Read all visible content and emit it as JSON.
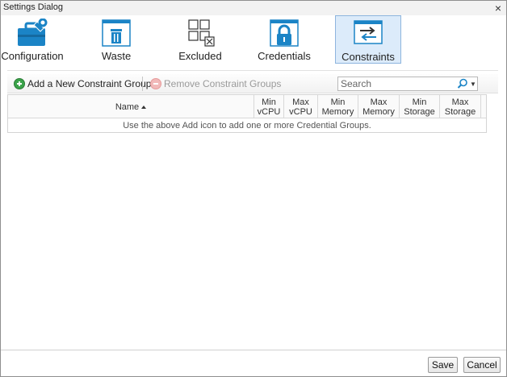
{
  "window": {
    "title": "Settings Dialog",
    "close_glyph": "×"
  },
  "tabs": [
    {
      "label": "Configuration",
      "icon": "toolbox-icon",
      "selected": false
    },
    {
      "label": "Waste",
      "icon": "trash-icon",
      "selected": false
    },
    {
      "label": "Excluded",
      "icon": "excluded-grid-icon",
      "selected": false
    },
    {
      "label": "Credentials",
      "icon": "lock-icon",
      "selected": false
    },
    {
      "label": "Constraints",
      "icon": "arrows-exchange-icon",
      "selected": true
    }
  ],
  "actions": {
    "add_label": "Add a New Constraint Group",
    "remove_label": "Remove Constraint Groups"
  },
  "search": {
    "placeholder": "Search",
    "value": ""
  },
  "grid": {
    "columns": [
      {
        "line1": "Name"
      },
      {
        "line1": "Min",
        "line2": "vCPU"
      },
      {
        "line1": "Max",
        "line2": "vCPU"
      },
      {
        "line1": "Min",
        "line2": "Memory"
      },
      {
        "line1": "Max",
        "line2": "Memory"
      },
      {
        "line1": "Min",
        "line2": "Storage"
      },
      {
        "line1": "Max",
        "line2": "Storage"
      }
    ],
    "empty_message": "Use the above Add icon to add one or more Credential Groups."
  },
  "footer": {
    "save_label": "Save",
    "cancel_label": "Cancel"
  },
  "colors": {
    "accent": "#1a7fc4",
    "selected_bg": "#dcebfa"
  }
}
